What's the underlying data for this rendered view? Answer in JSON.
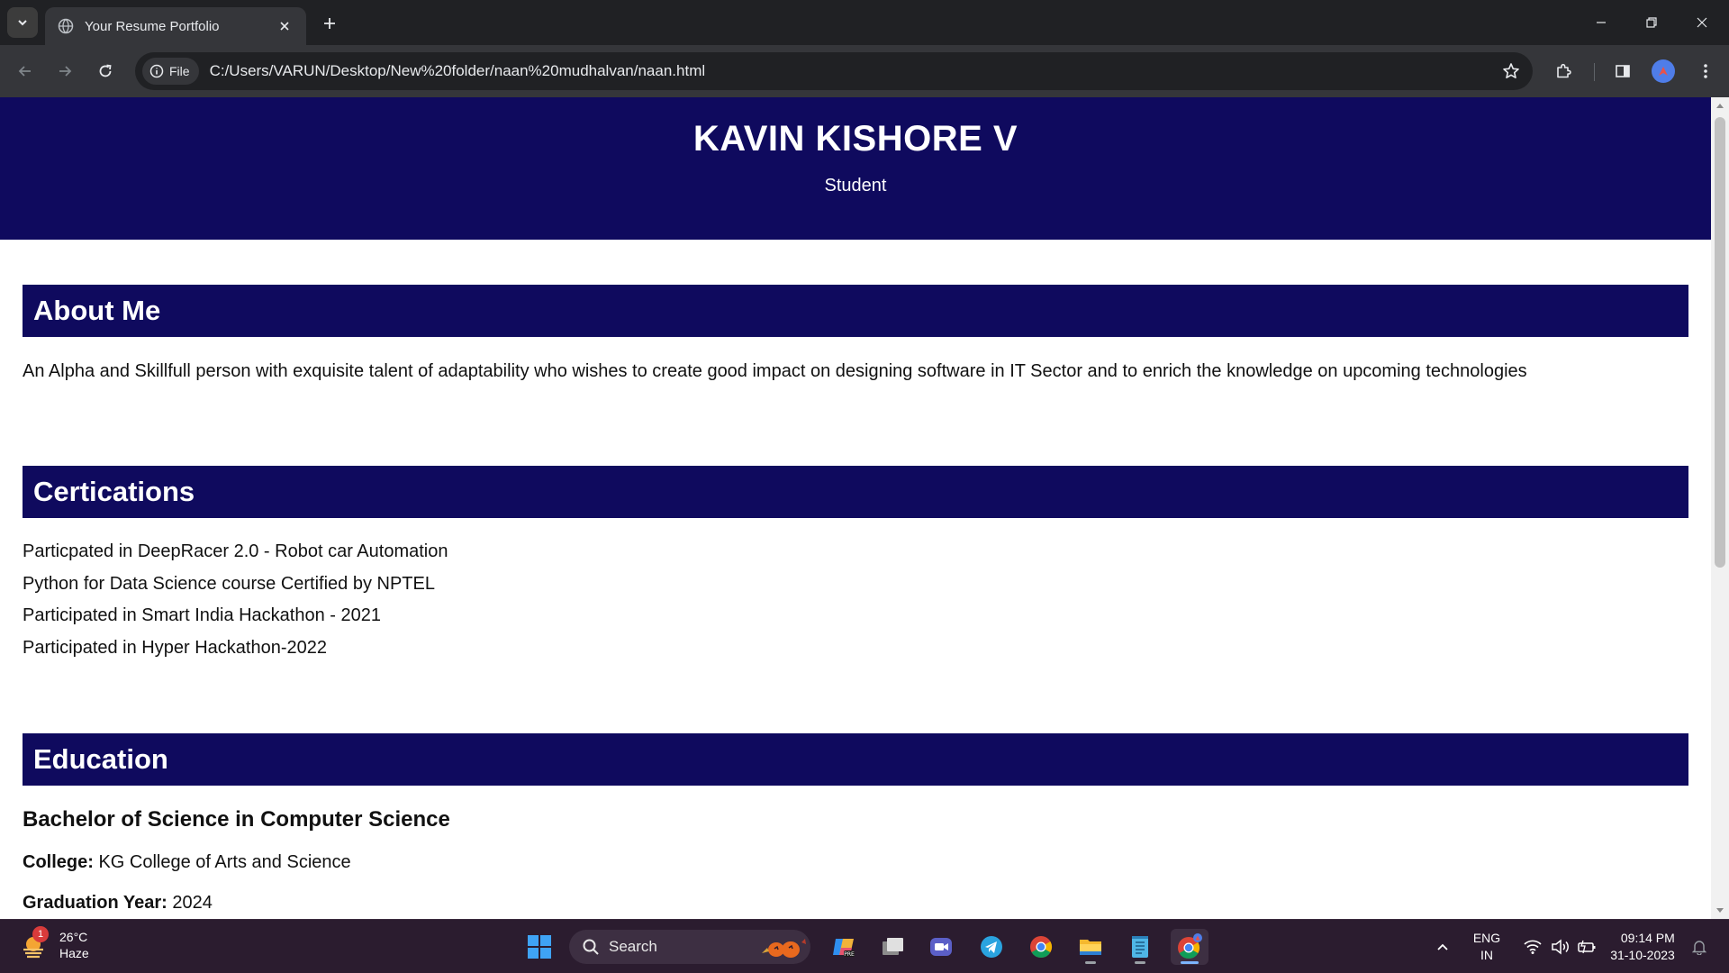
{
  "browser": {
    "tab_title": "Your Resume Portfolio",
    "chip_label": "File",
    "url": "C:/Users/VARUN/Desktop/New%20folder/naan%20mudhalvan/naan.html"
  },
  "page": {
    "header": {
      "name": "KAVIN KISHORE V",
      "role": "Student"
    },
    "about": {
      "title": "About Me",
      "text": "An Alpha and Skillfull person with exquisite talent of adaptability who wishes to create good impact on designing software in IT Sector and to enrich the knowledge on upcoming technologies"
    },
    "certifications": {
      "title": "Certications",
      "items": [
        "Particpated in DeepRacer 2.0 - Robot car Automation",
        "Python for Data Science course Certified by NPTEL",
        "Participated in Smart India Hackathon - 2021",
        "Participated in Hyper Hackathon-2022"
      ]
    },
    "education": {
      "title": "Education",
      "degree": "Bachelor of Science in Computer Science",
      "college_label": "College:",
      "college": "KG College of Arts and Science",
      "year_label": "Graduation Year:",
      "year": "2024"
    }
  },
  "taskbar": {
    "weather_temp": "26°C",
    "weather_desc": "Haze",
    "weather_badge": "1",
    "search_label": "Search",
    "lang_top": "ENG",
    "lang_bottom": "IN",
    "time": "09:14 PM",
    "date": "31-10-2023"
  },
  "colors": {
    "header_bg": "#0f0a5e",
    "browser_frame": "#202124",
    "taskbar_bg": "#2b1c2f"
  }
}
